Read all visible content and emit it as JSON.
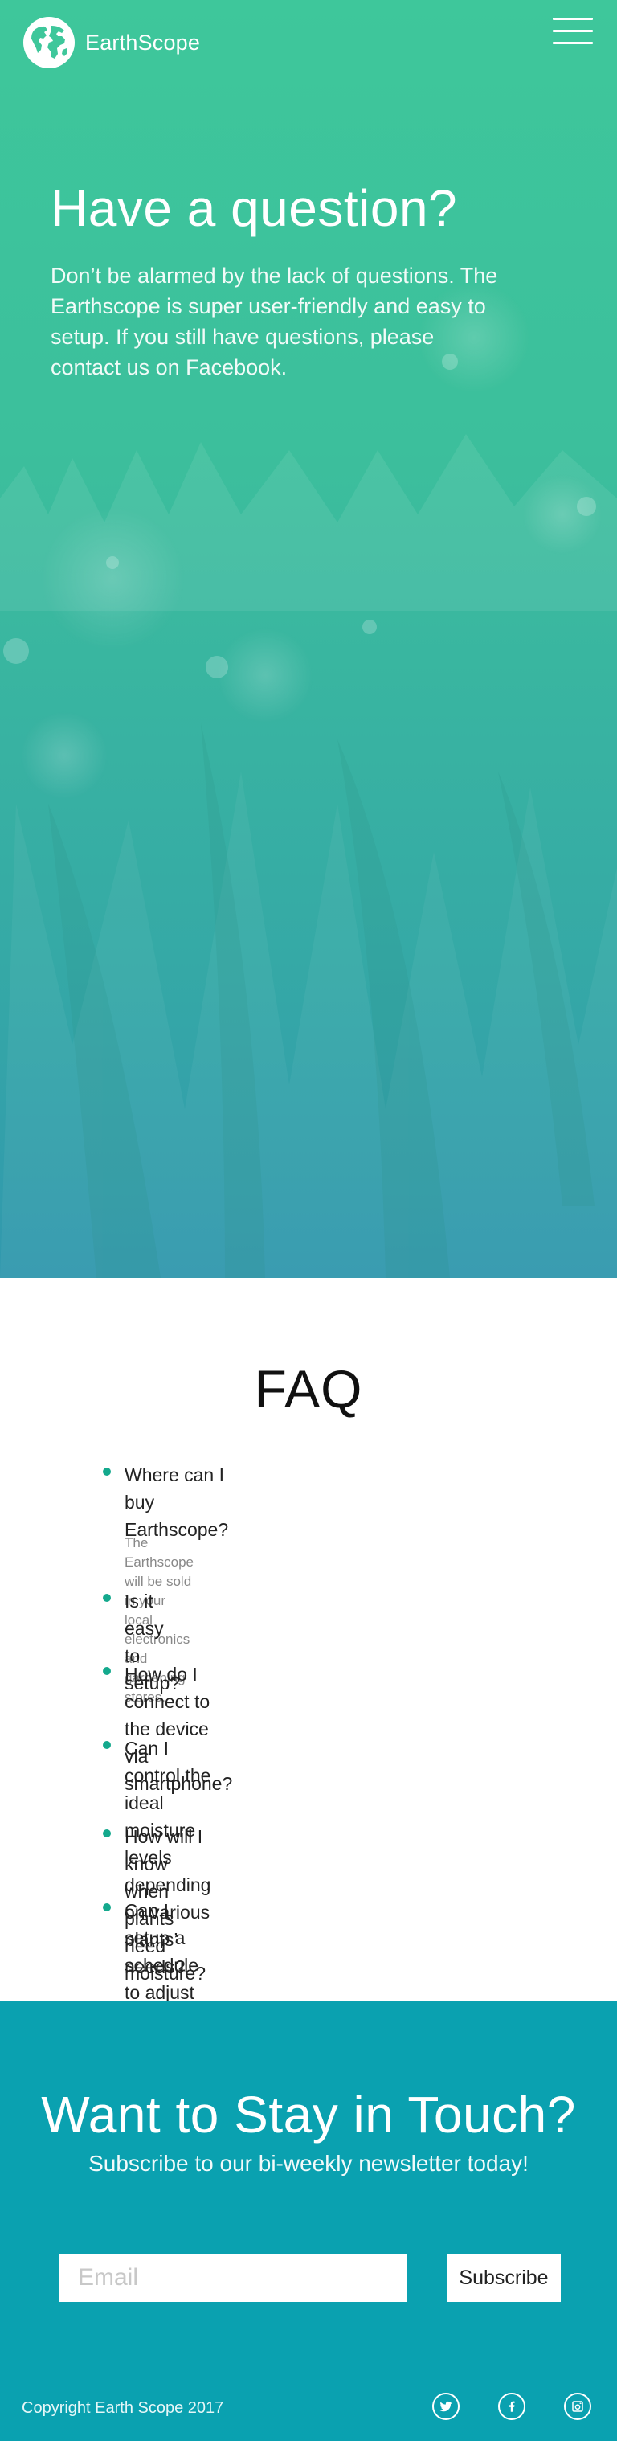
{
  "brand": {
    "name": "EarthScope",
    "logo_icon": "globe-icon"
  },
  "nav": {
    "menu_icon": "hamburger-menu-icon"
  },
  "hero": {
    "title": "Have a question?",
    "text": "Don’t be alarmed by the lack of questions. The Earthscope is super user-friendly and easy to setup. If you still have questions, please contact us on Facebook."
  },
  "faq": {
    "title": "FAQ",
    "items": [
      {
        "question": "Where can I buy\nEarthscope?",
        "answer": "The Earthscope will be sold in your local\nelectronics and gardening stores."
      },
      {
        "question": "Is it easy to\nsetup?"
      },
      {
        "question": "How do I connect to the device\nvia smartphone?"
      },
      {
        "question": "Can I control the ideal moisture levels\ndepending on various plants’ needs?"
      },
      {
        "question": "How will I know when plants\nneed moisture?"
      },
      {
        "question": "Can I setup a schedule to adjust how\nfrequently my plants are monitored?"
      }
    ]
  },
  "newsletter": {
    "title": "Want to Stay in Touch?",
    "subtitle": "Subscribe to our bi-weekly newsletter today!",
    "email_placeholder": "Email",
    "subscribe_label": "Subscribe"
  },
  "footer": {
    "copyright": "Copyright Earth Scope 2017",
    "social": [
      "twitter-icon",
      "facebook-icon",
      "instagram-icon"
    ]
  },
  "colors": {
    "hero_top": "#3ec79b",
    "hero_bottom": "#3198ae",
    "accent": "#14a98d",
    "newsletter_bg": "#0aa1b0"
  }
}
